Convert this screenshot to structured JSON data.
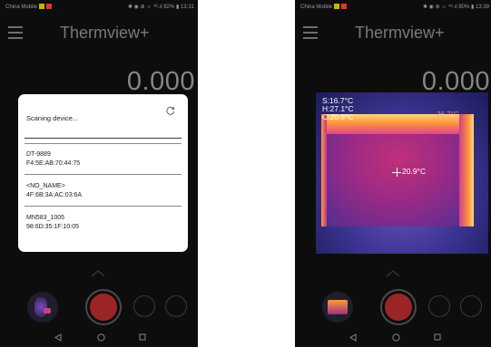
{
  "colors": {
    "background": "#0d0d0d",
    "record_red": "#9b2526",
    "title_gray": "#7a7a7a",
    "dialog_bg": "#ffffff"
  },
  "left_phone": {
    "status": {
      "carrier": "China Mobile",
      "right": "✱ ◉ ⊕ ☼ ⁴ᴳ.ıl 82% ▮ 13:31"
    },
    "app_title": "Thermview+",
    "reading": "0.000",
    "dialog": {
      "header": "Scaning device...",
      "devices": [
        {
          "name": "DT-9889",
          "address": "F4:5E:AB:70:44:75"
        },
        {
          "name": "<NO_NAME>",
          "address": "4F:6B:3A:AC:03:6A"
        },
        {
          "name": "MN583_1005",
          "address": "98:6D:35:1F:10:05"
        }
      ]
    }
  },
  "right_phone": {
    "status": {
      "carrier": "China Mobile",
      "right": "✱ ◉ ⊕ ☼ ⁴ᴳ.ıl 80% ▮ 13:39"
    },
    "app_title": "Thermview+",
    "reading": "0.000",
    "thermal": {
      "stats": [
        "S:16.7°C",
        "H:27.1°C",
        "C:20.9°C"
      ],
      "center_temp": "20.9°C",
      "max_label": "26.7°C"
    }
  }
}
